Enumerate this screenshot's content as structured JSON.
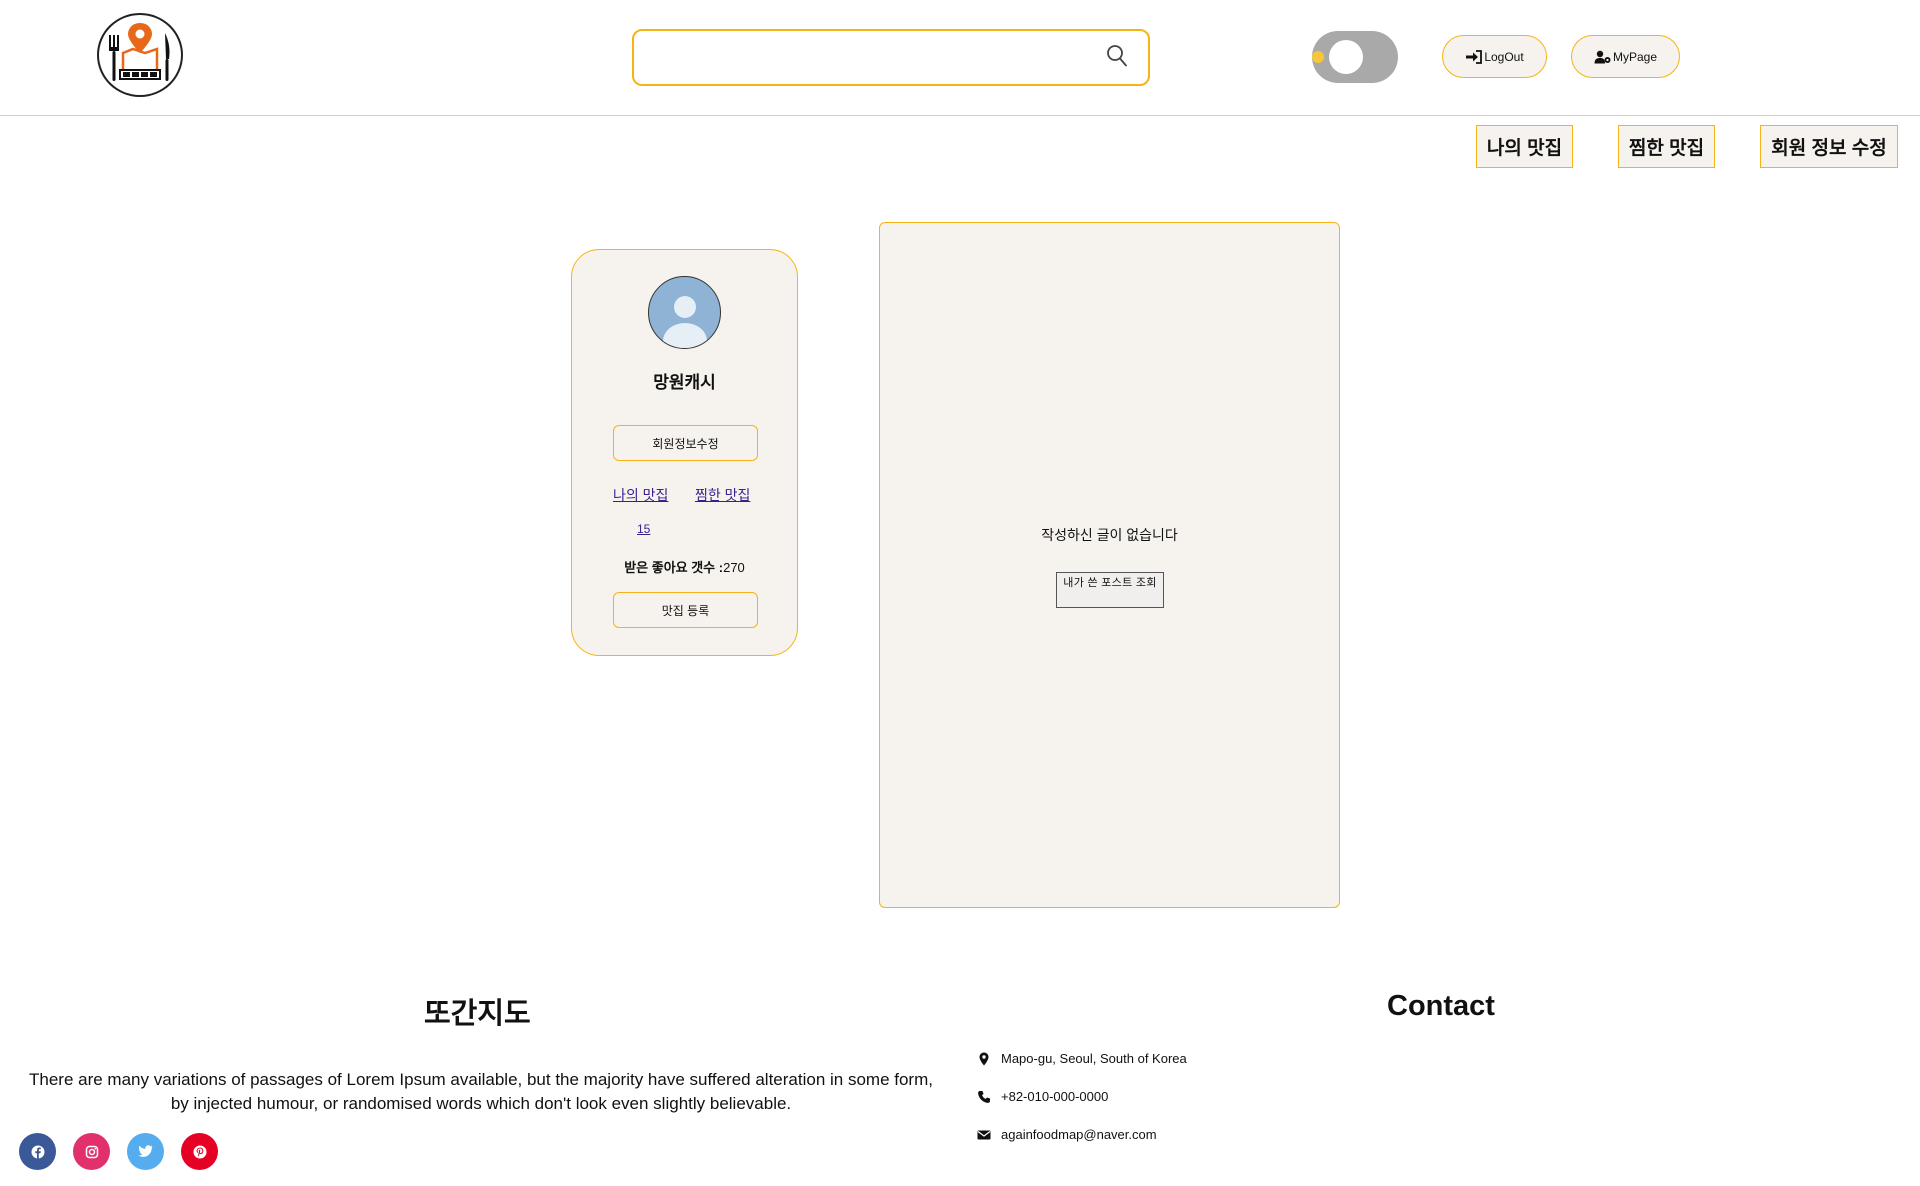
{
  "header": {
    "search": {
      "placeholder": "",
      "value": ""
    },
    "logout_label": "LogOut",
    "mypage_label": "MyPage"
  },
  "nav": {
    "my_places": "나의 맛집",
    "liked_places": "찜한 맛집",
    "edit_profile": "회원 정보 수정"
  },
  "profile": {
    "username": "망원캐시",
    "edit_button": "회원정보수정",
    "my_places_link": "나의 맛집",
    "liked_places_link": "찜한 맛집",
    "count": "15",
    "likes_label": "받은 좋아요 갯수 :",
    "likes_value": "270",
    "register_button": "맛집 등록"
  },
  "posts": {
    "empty_message": "작성하신 글이 없습니다",
    "view_button": "내가 쓴 포스트 조회"
  },
  "footer": {
    "brand": "또간지도",
    "description": "There are many variations of passages of Lorem Ipsum available, but the majority have suffered alteration in some form, by injected humour, or randomised words which don't look even slightly believable.",
    "contact_title": "Contact",
    "address": "Mapo-gu, Seoul, South of Korea",
    "phone": "+82-010-000-0000",
    "email": "againfoodmap@naver.com",
    "social": [
      "facebook-icon",
      "instagram-icon",
      "twitter-icon",
      "pinterest-icon"
    ]
  },
  "colors": {
    "accent": "#f5b316",
    "panel_bg": "#f6f3ee",
    "facebook": "#3b5998",
    "instagram": "#e1306c",
    "twitter": "#55acee",
    "pinterest": "#e60023"
  }
}
